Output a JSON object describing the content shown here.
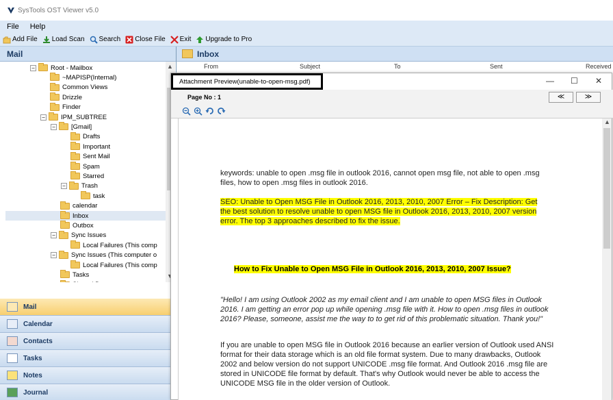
{
  "window": {
    "title": "SysTools OST Viewer v5.0"
  },
  "menu": [
    "File",
    "Help"
  ],
  "toolbar": {
    "add_file": "Add File",
    "load_scan": "Load Scan",
    "search": "Search",
    "close_file": "Close File",
    "exit": "Exit",
    "upgrade": "Upgrade to Pro"
  },
  "left_pane": {
    "title": "Mail",
    "tree": [
      {
        "label": "Root - Mailbox",
        "depth": 0,
        "expander": "−"
      },
      {
        "label": "~MAPISP(Internal)",
        "depth": 1
      },
      {
        "label": "Common Views",
        "depth": 1
      },
      {
        "label": "Drizzle",
        "depth": 1
      },
      {
        "label": "Finder",
        "depth": 1
      },
      {
        "label": "IPM_SUBTREE",
        "depth": 1,
        "expander": "−"
      },
      {
        "label": "[Gmail]",
        "depth": 2,
        "expander": "−"
      },
      {
        "label": "Drafts",
        "depth": 3
      },
      {
        "label": "Important",
        "depth": 3
      },
      {
        "label": "Sent Mail",
        "depth": 3
      },
      {
        "label": "Spam",
        "depth": 3
      },
      {
        "label": "Starred",
        "depth": 3
      },
      {
        "label": "Trash",
        "depth": 3,
        "expander": "−"
      },
      {
        "label": "task",
        "depth": 4
      },
      {
        "label": "calendar",
        "depth": 2
      },
      {
        "label": "Inbox",
        "depth": 2,
        "selected": true
      },
      {
        "label": "Outbox",
        "depth": 2
      },
      {
        "label": "Sync Issues",
        "depth": 2,
        "expander": "−"
      },
      {
        "label": "Local Failures (This comp",
        "depth": 3
      },
      {
        "label": "Sync Issues (This computer o",
        "depth": 2,
        "expander": "−"
      },
      {
        "label": "Local Failures (This comp",
        "depth": 3
      },
      {
        "label": "Tasks",
        "depth": 2
      },
      {
        "label": "Shared Data",
        "depth": 2
      }
    ],
    "nav": [
      "Mail",
      "Calendar",
      "Contacts",
      "Tasks",
      "Notes",
      "Journal"
    ]
  },
  "inbox": {
    "title": "Inbox",
    "columns": [
      "From",
      "Subject",
      "To",
      "Sent",
      "Received"
    ]
  },
  "preview": {
    "title": "Attachment Preview(unable-to-open-msg.pdf)",
    "page_label": "Page No :",
    "page_value": "1",
    "prev": "≪",
    "next": "≫",
    "doc": {
      "keywords": "keywords: unable to open .msg file in outlook 2016, cannot open msg file, not able to open .msg files, how to open .msg files in outlook 2016.",
      "seo": "SEO: Unable to Open MSG File in Outlook 2016, 2013, 2010, 2007 Error – Fix Description: Get the best solution to resolve unable to open MSG file in Outlook 2016, 2013, 2010, 2007 version error. The top 3 approaches described to fix the issue.",
      "heading": "How to Fix Unable to Open MSG File in Outlook 2016, 2013, 2010, 2007 Issue?",
      "quote": "\"Hello! I am using Outlook 2002 as my email client and I am unable to open MSG files in Outlook 2016. I am getting an error pop up while opening .msg file with it. How to open .msg files in outlook 2016? Please, someone, assist me the way to to get rid of this problematic situation. Thank you!\"",
      "body": "If you are unable to open MSG file in Outlook 2016 because an earlier version of Outlook used ANSI format for their data storage which is an old file format system. Due to many drawbacks, Outlook 2002 and below version do not support UNICODE .msg file format. And Outlook 2016 .msg file are stored in UNICODE file format by default. That's why Outlook would never be able to access the UNICODE MSG file in the older version of Outlook."
    }
  }
}
